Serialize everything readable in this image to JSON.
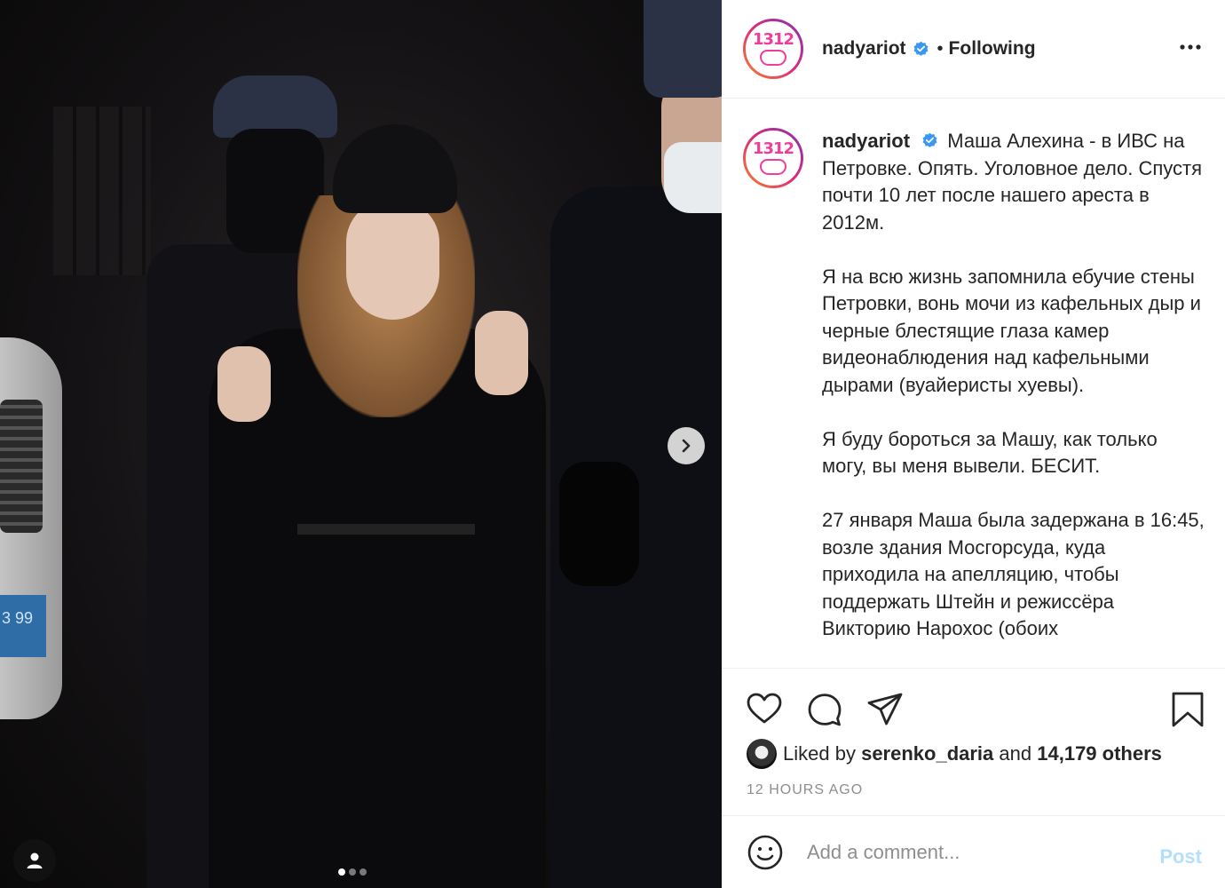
{
  "post": {
    "username": "nadyariot",
    "separator": "•",
    "follow_state": "Following",
    "more_icon": "more-horizontal-icon",
    "avatar_text": "1312",
    "caption_paragraphs": [
      "Маша Алехина - в ИВС на Петровке. Опять. Уголовное дело. Спустя почти 10 лет после нашего ареста в 2012м.",
      "Я на всю жизнь запомнила ебучие стены Петровки, вонь мочи из кафельных дыр и черные блестящие глаза камер видеонаблюдения над кафельными дырами (вуайеристы хуевы).",
      "Я буду бороться за Машу, как только могу, вы меня вывели. БЕСИТ.",
      "27 января Маша была задержана в 16:45, возле здания Мосгорсуда, куда приходила на апелляцию, чтобы поддержать Штейн и режиссёра Викторию Нарохос (обоих"
    ],
    "likes": {
      "prefix": "Liked by",
      "liker": "serenko_daria",
      "joiner": "and",
      "others": "14,179 others"
    },
    "timestamp": "12 HOURS AGO",
    "comment_placeholder": "Add a comment...",
    "post_label": "Post",
    "photo": {
      "plate_text": "3 99",
      "carousel_dots": 3,
      "active_dot": 0
    }
  },
  "icons": {
    "like": "heart-icon",
    "comment": "comment-icon",
    "share": "send-icon",
    "save": "bookmark-icon",
    "emoji": "smiley-icon",
    "next": "chevron-right-icon",
    "tag": "user-tag-icon",
    "verified": "verified-badge-icon"
  },
  "colors": {
    "verified": "#3897f0",
    "post_disabled": "#b2dffc",
    "muted": "#8e8e8e",
    "avatar_pink": "#f03c9b"
  }
}
